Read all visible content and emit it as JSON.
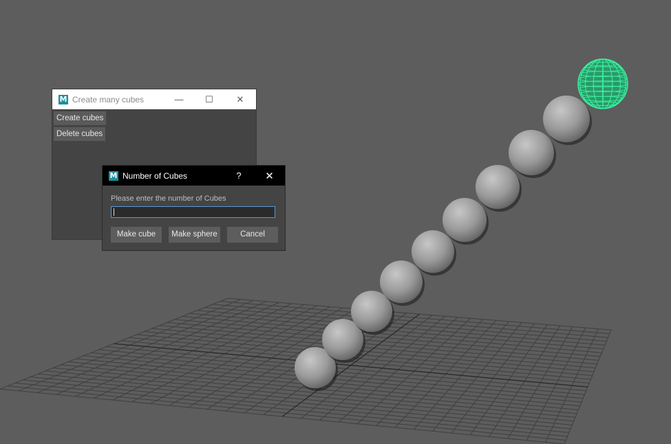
{
  "main_window": {
    "title": "Create many cubes",
    "icon": "maya-logo-icon",
    "logo_letter": "M",
    "controls": {
      "minimize": "—",
      "maximize": "☐",
      "close": "✕"
    },
    "buttons": [
      "Create cubes",
      "Delete cubes"
    ]
  },
  "dialog": {
    "title": "Number of Cubes",
    "logo_letter": "M",
    "help": "?",
    "close": "✕",
    "prompt": "Please enter the number of Cubes",
    "input_value": "",
    "buttons": {
      "make_cube": "Make cube",
      "make_sphere": "Make sphere",
      "cancel": "Cancel"
    }
  },
  "scene": {
    "background": "#5d5d5d",
    "grid_color": "#3f3f3f",
    "sphere_color": "#9a9a9a",
    "selected_color": "#3ef0a0",
    "sphere_count": 10,
    "selected_sphere": "last"
  }
}
